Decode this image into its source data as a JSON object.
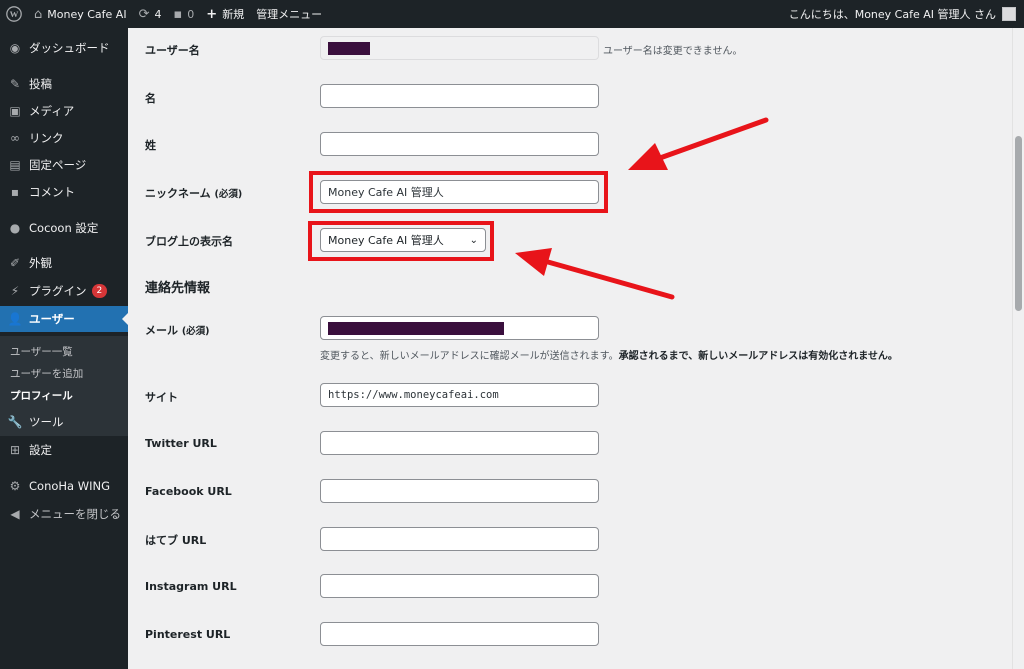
{
  "adminbar": {
    "site_name": "Money Cafe AI",
    "updates_count": "4",
    "comments_count": "0",
    "new_label": "新規",
    "admin_menu_label": "管理メニュー",
    "greeting": "こんにちは、Money Cafe AI 管理人 さん"
  },
  "sidebar": {
    "dashboard": "ダッシュボード",
    "posts": "投稿",
    "media": "メディア",
    "links": "リンク",
    "pages": "固定ページ",
    "comments": "コメント",
    "cocoon": "Cocoon 設定",
    "appearance": "外観",
    "plugins": "プラグイン",
    "plugins_badge": "2",
    "users": "ユーザー",
    "users_sub": [
      "ユーザー一覧",
      "ユーザーを追加",
      "プロフィール"
    ],
    "tools": "ツール",
    "settings": "設定",
    "conoha": "ConoHa WING",
    "collapse": "メニューを閉じる"
  },
  "form": {
    "username_label": "ユーザー名",
    "username_note": "ユーザー名は変更できません。",
    "firstname_label": "名",
    "lastname_label": "姓",
    "nickname_label": "ニックネーム",
    "required": "(必須)",
    "nickname_value": "Money Cafe AI 管理人",
    "display_name_label": "ブログ上の表示名",
    "display_name_value": "Money Cafe AI 管理人",
    "contact_heading": "連絡先情報",
    "email_label": "メール",
    "email_note_plain": "変更すると、新しいメールアドレスに確認メールが送信されます。",
    "email_note_bold": "承認されるまで、新しいメールアドレスは有効化されません。",
    "site_label": "サイト",
    "site_value": "https://www.moneycafeai.com",
    "twitter_label": "Twitter URL",
    "facebook_label": "Facebook URL",
    "hatena_label": "はてブ URL",
    "instagram_label": "Instagram URL",
    "pinterest_label": "Pinterest URL"
  },
  "colors": {
    "highlight": "#e8141a",
    "admin_bg": "#1d2327",
    "accent": "#2271b1"
  }
}
